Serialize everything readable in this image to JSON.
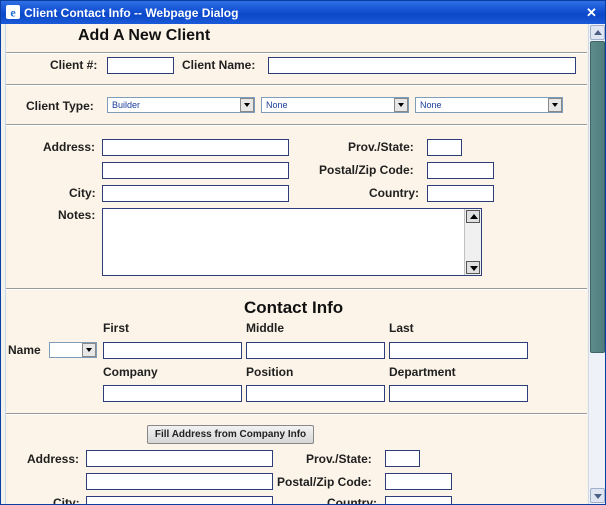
{
  "window": {
    "title": "Client Contact Info -- Webpage Dialog",
    "close_glyph": "✕"
  },
  "client": {
    "heading": "Add A New Client",
    "number_label": "Client #:",
    "name_label": "Client Name:",
    "number_value": "",
    "name_value": "",
    "type_label": "Client Type:",
    "type_selects": [
      "Builder",
      "None",
      "None"
    ]
  },
  "address": {
    "address_label": "Address:",
    "prov_label": "Prov./State:",
    "postal_label": "Postal/Zip Code:",
    "city_label": "City:",
    "country_label": "Country:",
    "notes_label": "Notes:"
  },
  "contact": {
    "heading": "Contact Info",
    "name_label": "Name",
    "first_label": "First",
    "middle_label": "Middle",
    "last_label": "Last",
    "company_label": "Company",
    "position_label": "Position",
    "department_label": "Department",
    "fill_button": "Fill Address from Company Info",
    "address_label": "Address:",
    "prov_label": "Prov./State:",
    "postal_label": "Postal/Zip Code:",
    "city_label": "City:",
    "country_label": "Country:"
  },
  "colors": {
    "titlebar": "#0b48c9",
    "content_bg": "#fcf4e8",
    "scroll_thumb": "#5f8b8b"
  }
}
